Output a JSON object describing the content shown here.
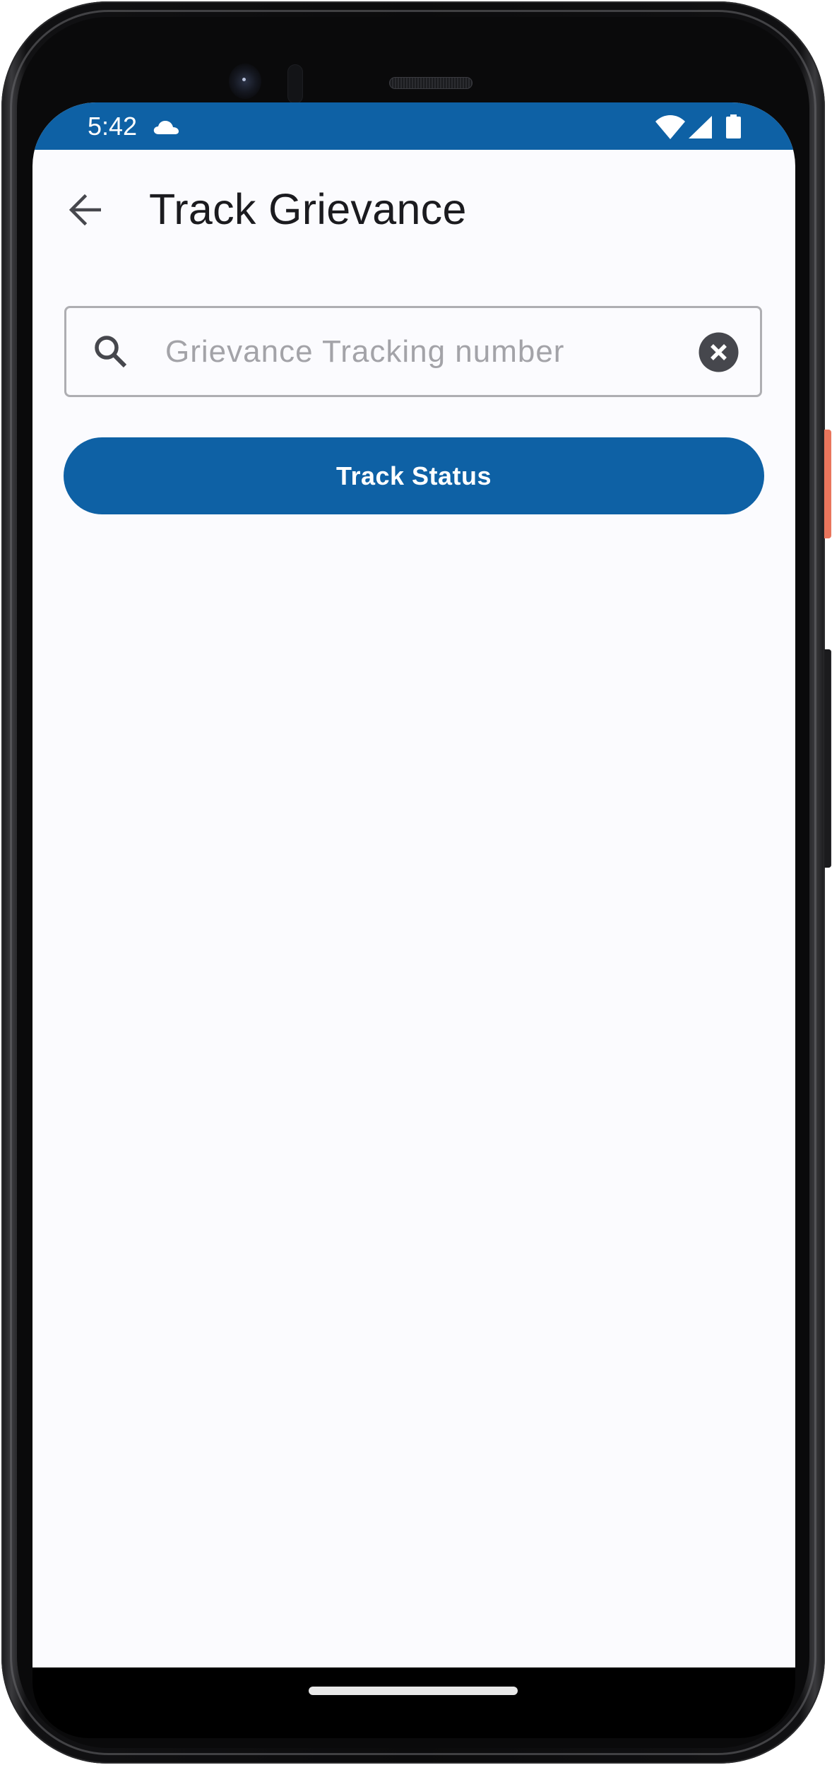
{
  "status_bar": {
    "time": "5:42",
    "icons": [
      "cloud-icon",
      "wifi-icon",
      "cellular-signal-icon",
      "battery-icon"
    ],
    "background_color": "#0e61a5"
  },
  "app_bar": {
    "back_icon": "arrow-back-icon",
    "title": "Track Grievance"
  },
  "search": {
    "value": "",
    "placeholder": "Grievance Tracking number",
    "leading_icon": "search-icon",
    "trailing_icon": "clear-icon"
  },
  "primary_action": {
    "label": "Track Status",
    "color": "#0e61a5"
  },
  "theme": {
    "accent": "#0e61a5",
    "background": "#fbfbfe",
    "text_primary": "#1b1b1f",
    "placeholder": "#a3a3a8",
    "icon": "#46474d"
  }
}
